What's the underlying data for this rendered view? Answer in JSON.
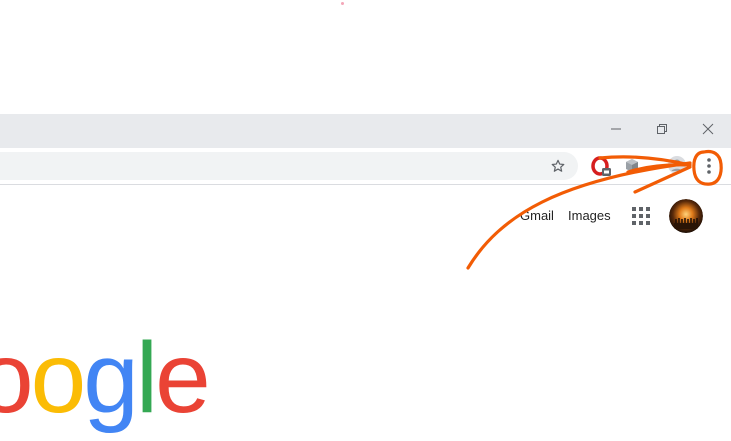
{
  "window": {
    "minimize_icon": "minimize-icon",
    "restore_icon": "restore-icon",
    "close_icon": "close-icon"
  },
  "toolbar": {
    "bookmark_icon": "star-icon",
    "extensions": [
      "opera-extension-icon",
      "cube-extension-icon"
    ],
    "profile_icon": "profile-icon",
    "menu_icon": "vertical-dots-menu-icon"
  },
  "google_header": {
    "gmail": "Gmail",
    "images": "Images",
    "apps_icon": "apps-grid-icon",
    "avatar": "user-avatar"
  },
  "logo": {
    "letters": [
      {
        "char": "o",
        "color": "#EA4335"
      },
      {
        "char": "o",
        "color": "#FBBC05"
      },
      {
        "char": "g",
        "color": "#4285F4"
      },
      {
        "char": "l",
        "color": "#34A853"
      },
      {
        "char": "e",
        "color": "#EA4335"
      }
    ]
  },
  "colors": {
    "titlebar": "#e8eaed",
    "omnibox": "#f1f3f4",
    "annotation": "#f25c05",
    "icon_gray": "#5f6368"
  }
}
